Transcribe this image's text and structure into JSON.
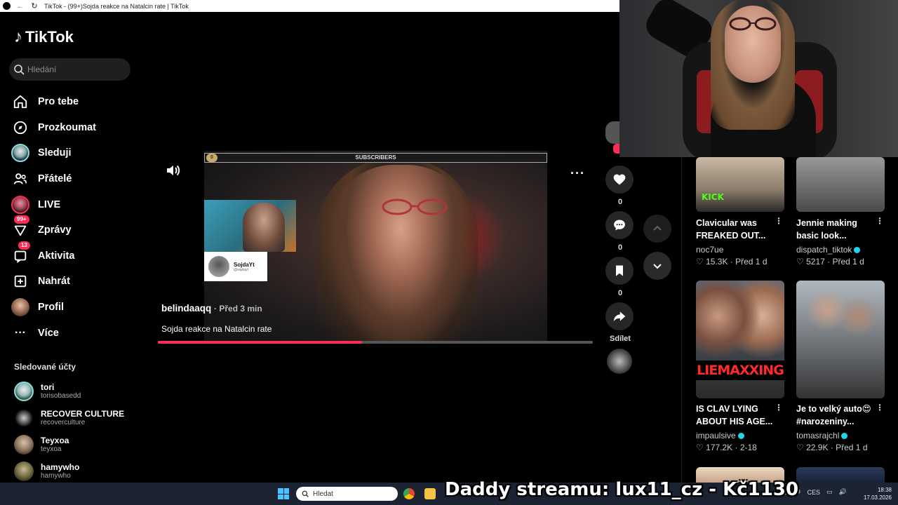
{
  "browser": {
    "tab_title": "TikTok - (99+)Sojda reakce na Natalcin rate | TikTok"
  },
  "logo": {
    "text": "TikTok"
  },
  "search": {
    "placeholder": "Hledání"
  },
  "nav": [
    {
      "label": "Pro tebe",
      "icon": "home-icon"
    },
    {
      "label": "Prozkoumat",
      "icon": "compass-icon"
    },
    {
      "label": "Sleduji",
      "icon": "following-avatar"
    },
    {
      "label": "Přátelé",
      "icon": "friends-icon"
    },
    {
      "label": "LIVE",
      "icon": "live-avatar"
    },
    {
      "label": "Zprávy",
      "icon": "messages-icon",
      "badge": "99+"
    },
    {
      "label": "Aktivita",
      "icon": "activity-icon",
      "badge": "13"
    },
    {
      "label": "Nahrát",
      "icon": "upload-icon"
    },
    {
      "label": "Profil",
      "icon": "profile-avatar"
    },
    {
      "label": "Více",
      "icon": "more-icon"
    }
  ],
  "followed": {
    "heading": "Sledované účty",
    "accounts": [
      {
        "name": "tori",
        "handle": "torisobasedd"
      },
      {
        "name": "RECOVER CULTURE",
        "handle": "recoverculture"
      },
      {
        "name": "Teyxoa",
        "handle": "teyxoa"
      },
      {
        "name": "hamywho",
        "handle": "hamywho"
      }
    ]
  },
  "video": {
    "author": "belindaaqq",
    "time": "· Před 3 min",
    "description": "Sojda reakce na Natalcin rate",
    "overlay_bar_label": "SUBSCRIBERS",
    "overlay_bar_count": "0",
    "card_name": "SojdaYt",
    "card_handle": "@sojdayt",
    "progress": 0.47
  },
  "actions": {
    "likes": "0",
    "comments": "0",
    "saves": "0",
    "share_label": "Sdílet"
  },
  "recommended": [
    {
      "title": "Clavicular was FREAKED OUT...",
      "user": "noc7ue",
      "verified": false,
      "views": "15.3K",
      "date": "Před 1 d",
      "thumb_text": "KICK"
    },
    {
      "title": "Jennie making basic look...",
      "user": "dispatch_tiktok",
      "verified": true,
      "views": "5217",
      "date": "Před 1 d"
    },
    {
      "title": "IS CLAV LYING ABOUT HIS AGE...",
      "user": "impaulsive",
      "verified": true,
      "views": "177.2K",
      "date": "2-18",
      "thumb_text": "LIEMAXXING"
    },
    {
      "title": "Je to velký auto😍 #narozeniny...",
      "user": "tomasrajchl",
      "verified": true,
      "views": "22.9K",
      "date": "Před 1 d"
    }
  ],
  "stream_overlay": "Daddy streamu: lux11_cz - Kč1130",
  "taskbar": {
    "search_placeholder": "Hledat",
    "lang": "CES",
    "time": "18:38",
    "date": "17.03.2026"
  },
  "colors": {
    "accent": "#fe2c55",
    "verified": "#20d5ec"
  }
}
